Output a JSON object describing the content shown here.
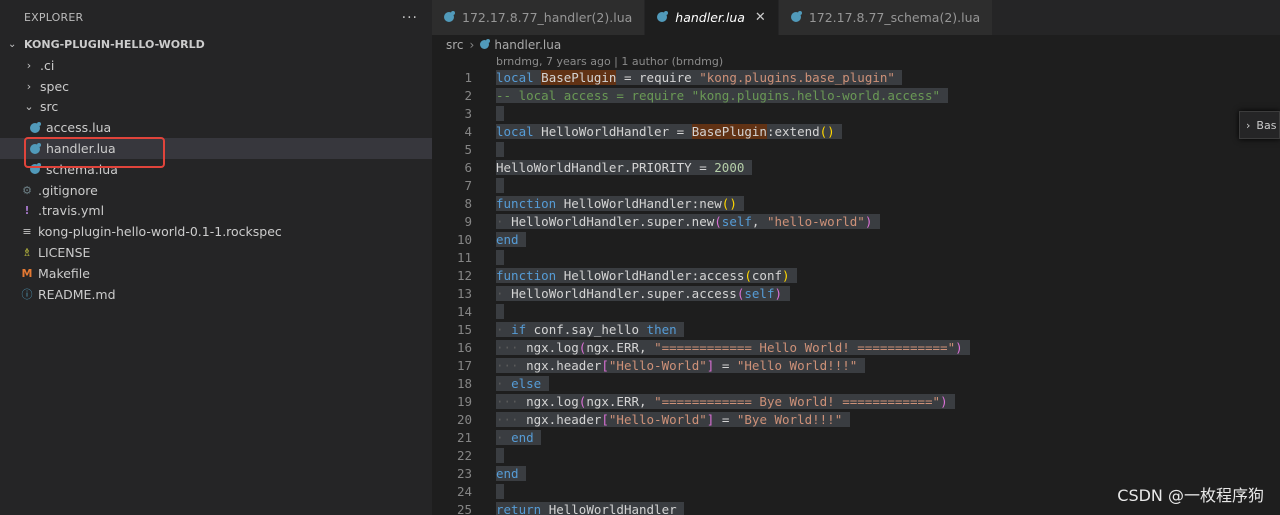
{
  "sidebar": {
    "title": "EXPLORER",
    "more": "···",
    "section": "KONG-PLUGIN-HELLO-WORLD",
    "items": [
      {
        "label": ".ci",
        "twisty": "›",
        "icon": ""
      },
      {
        "label": "spec",
        "twisty": "›",
        "icon": ""
      },
      {
        "label": "src",
        "twisty": "⌄",
        "icon": ""
      },
      {
        "label": "access.lua",
        "icon": "lua-icon"
      },
      {
        "label": "handler.lua",
        "icon": "lua-icon"
      },
      {
        "label": "schema.lua",
        "icon": "lua-icon"
      },
      {
        "label": ".gitignore",
        "icon": "gear-icon"
      },
      {
        "label": ".travis.yml",
        "icon": "exclamation-icon"
      },
      {
        "label": "kong-plugin-hello-world-0.1-1.rockspec",
        "icon": "lines-icon"
      },
      {
        "label": "LICENSE",
        "icon": "license-icon"
      },
      {
        "label": "Makefile",
        "icon": "makefile-icon"
      },
      {
        "label": "README.md",
        "icon": "info-icon"
      }
    ]
  },
  "tabs": [
    {
      "label": "172.17.8.77_handler(2).lua",
      "active": false
    },
    {
      "label": "handler.lua",
      "active": true,
      "close": "✕"
    },
    {
      "label": "172.17.8.77_schema(2).lua",
      "active": false
    }
  ],
  "breadcrumb": {
    "folder": "src",
    "sep": "›",
    "file": "handler.lua"
  },
  "editor": {
    "blame": "brndmg, 7 years ago | 1 author (brndmg)",
    "line_numbers": [
      "1",
      "2",
      "3",
      "4",
      "5",
      "6",
      "7",
      "8",
      "9",
      "10",
      "11",
      "12",
      "13",
      "14",
      "15",
      "16",
      "17",
      "18",
      "19",
      "20",
      "21",
      "22",
      "23",
      "24",
      "25"
    ]
  },
  "minimap_button": "Bas",
  "watermark": "CSDN @一枚程序狗",
  "colors": {
    "keyword": "#569cd6",
    "string": "#ce9178",
    "comment": "#6a9955",
    "number": "#b5cea8",
    "highlight_box": "#e0443b"
  }
}
